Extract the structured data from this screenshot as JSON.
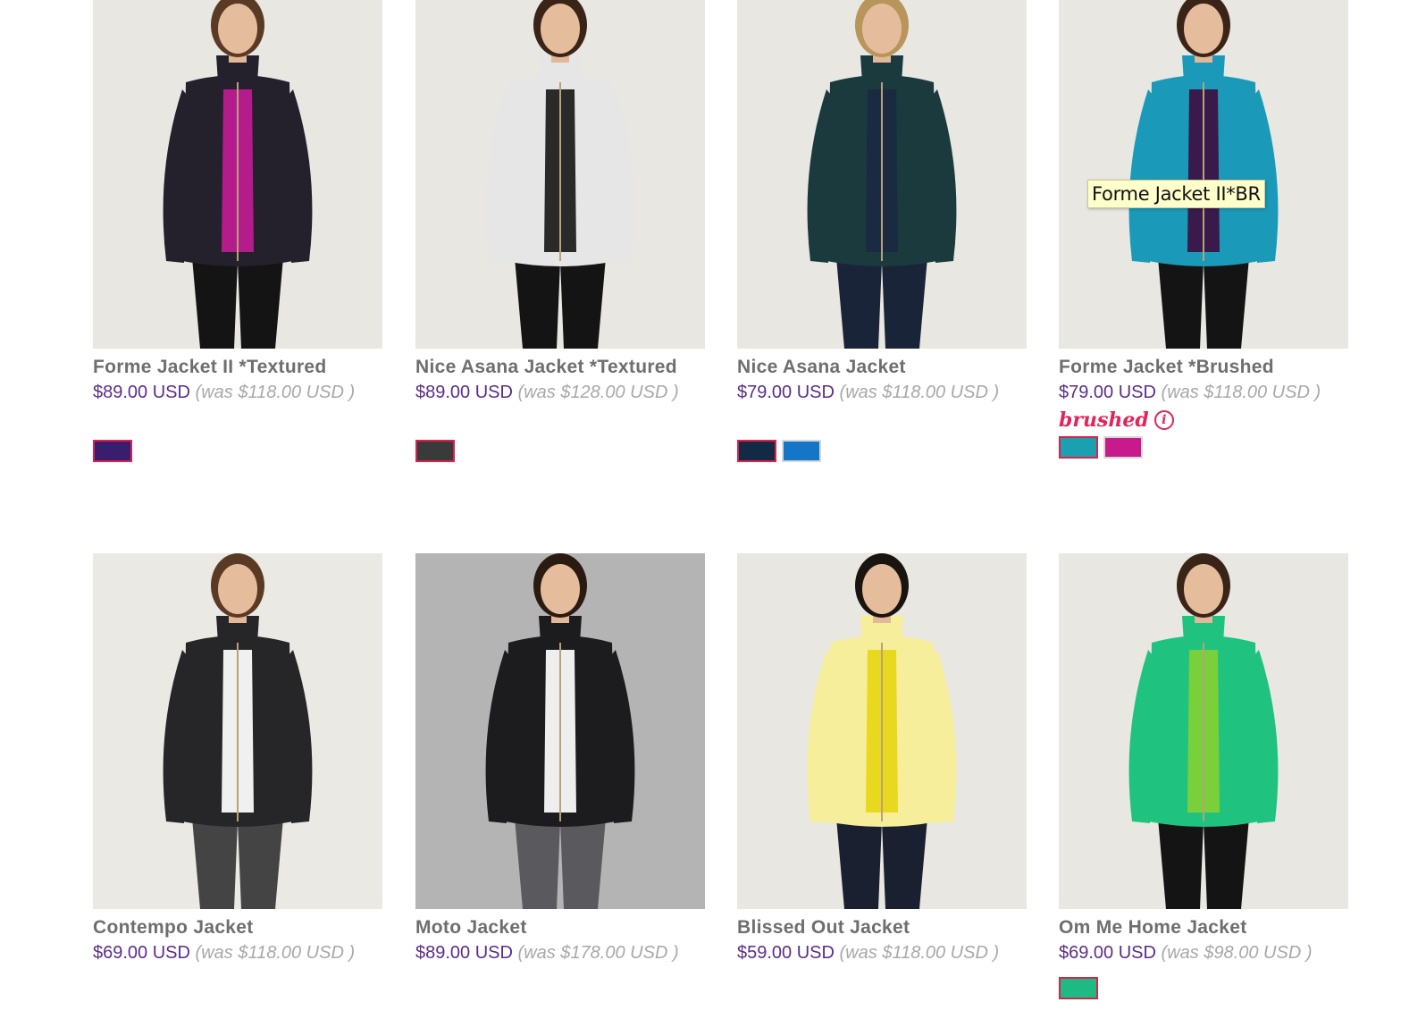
{
  "products": [
    {
      "name": "Forme Jacket II *Textured",
      "sale_price": "$89.00 USD",
      "was_price": "(was $118.00 USD )",
      "swatches": [
        "#3a1d6e"
      ],
      "photo": {
        "bg": "#e8e7e1",
        "jacket": "#24202c",
        "top": "#b41c8c",
        "pants": "#141414",
        "hair": "#5a3a24"
      }
    },
    {
      "name": "Nice Asana Jacket *Textured",
      "sale_price": "$89.00 USD",
      "was_price": "(was $128.00 USD )",
      "swatches": [
        "#3a3a3a"
      ],
      "photo": {
        "bg": "#e8e7e1",
        "jacket": "#e6e6e6",
        "top": "#2a2a2a",
        "pants": "#141414",
        "hair": "#3a2418"
      }
    },
    {
      "name": "Nice Asana Jacket",
      "sale_price": "$79.00 USD",
      "was_price": "(was $118.00 USD )",
      "swatches": [
        "#142a44",
        "#1576c8"
      ],
      "photo": {
        "bg": "#e8e7e1",
        "jacket": "#1a3a3e",
        "top": "#1a2a40",
        "pants": "#1a2438",
        "hair": "#b8955a"
      }
    },
    {
      "name": "Forme Jacket *Brushed",
      "sale_price": "$79.00 USD",
      "was_price": "(was $118.00 USD )",
      "badge": "brushed",
      "swatches": [
        "#1aa0b0",
        "#c81a8c"
      ],
      "photo": {
        "bg": "#e8e7e1",
        "jacket": "#1a9ab8",
        "top": "#3a1a4a",
        "pants": "#141414",
        "hair": "#3a2418"
      }
    },
    {
      "name": "Contempo Jacket",
      "sale_price": "$69.00 USD",
      "was_price": "(was $118.00 USD )",
      "swatches": [],
      "photo": {
        "bg": "#eae9e3",
        "jacket": "#262628",
        "top": "#f0f0f0",
        "pants": "#444444",
        "hair": "#5a3a24"
      }
    },
    {
      "name": "Moto Jacket",
      "sale_price": "$89.00 USD",
      "was_price": "(was $178.00 USD )",
      "swatches": [],
      "photo": {
        "bg": "#b4b4b4",
        "jacket": "#1c1c1e",
        "top": "#eeeeee",
        "pants": "#5a5a5e",
        "hair": "#2a1a12"
      }
    },
    {
      "name": "Blissed Out Jacket",
      "sale_price": "$59.00 USD",
      "was_price": "(was $118.00 USD )",
      "swatches": [],
      "photo": {
        "bg": "#e8e7e1",
        "jacket": "#f6ee9a",
        "top": "#e8d820",
        "pants": "#1a2030",
        "hair": "#1a1410"
      }
    },
    {
      "name": "Om Me Home Jacket",
      "sale_price": "$69.00 USD",
      "was_price": "(was $98.00 USD )",
      "swatches": [
        "#1fba84"
      ],
      "photo": {
        "bg": "#e8e7e1",
        "jacket": "#20c280",
        "top": "#7ad03a",
        "pants": "#141414",
        "hair": "#3a2418"
      }
    }
  ],
  "tooltip": "Forme Jacket II*BR",
  "colors": {
    "sale": "#5a2d8a",
    "was": "#a8a8a8",
    "title": "#6e6e6e",
    "badge": "#e0255a",
    "swatch_selected_border": "#d8244c"
  }
}
